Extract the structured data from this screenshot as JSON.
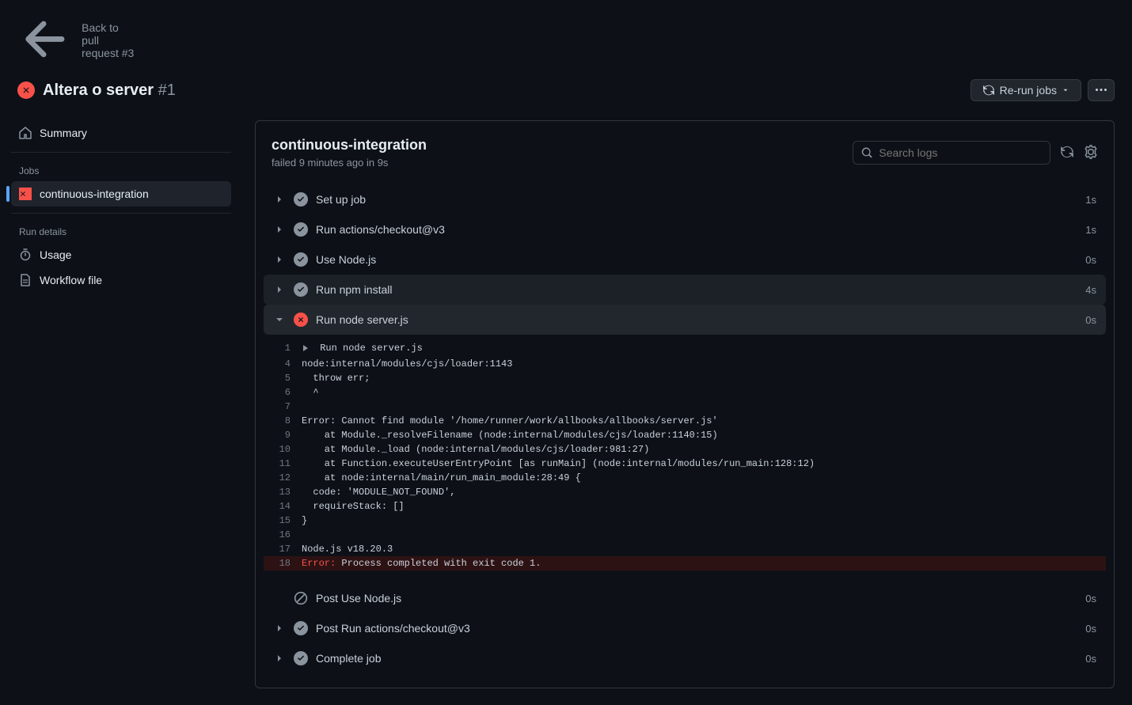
{
  "header": {
    "back_label": "Back to pull request #3",
    "title": "Altera o server",
    "title_number": "#1",
    "rerun_label": "Re-run jobs"
  },
  "sidebar": {
    "summary_label": "Summary",
    "jobs_heading": "Jobs",
    "jobs": [
      {
        "label": "continuous-integration",
        "status": "fail"
      }
    ],
    "details_heading": "Run details",
    "usage_label": "Usage",
    "workflow_label": "Workflow file"
  },
  "main": {
    "title": "continuous-integration",
    "subtitle": "failed 9 minutes ago in 9s",
    "search_placeholder": "Search logs"
  },
  "steps": [
    {
      "label": "Set up job",
      "status": "success",
      "time": "1s",
      "chev": true
    },
    {
      "label": "Run actions/checkout@v3",
      "status": "success",
      "time": "1s",
      "chev": true
    },
    {
      "label": "Use Node.js",
      "status": "success",
      "time": "0s",
      "chev": true
    },
    {
      "label": "Run npm install",
      "status": "success",
      "time": "4s",
      "chev": true,
      "hovered": true
    },
    {
      "label": "Run node server.js",
      "status": "fail",
      "time": "0s",
      "chev": true,
      "expanded": true
    },
    {
      "label": "Post Use Node.js",
      "status": "skip",
      "time": "0s",
      "chev": false
    },
    {
      "label": "Post Run actions/checkout@v3",
      "status": "success",
      "time": "0s",
      "chev": true
    },
    {
      "label": "Complete job",
      "status": "success",
      "time": "0s",
      "chev": true
    }
  ],
  "log": [
    {
      "n": "1",
      "fold": true,
      "text": "Run node server.js"
    },
    {
      "n": "4",
      "text": "node:internal/modules/cjs/loader:1143"
    },
    {
      "n": "5",
      "text": "  throw err;"
    },
    {
      "n": "6",
      "text": "  ^"
    },
    {
      "n": "7",
      "text": ""
    },
    {
      "n": "8",
      "text": "Error: Cannot find module '/home/runner/work/allbooks/allbooks/server.js'"
    },
    {
      "n": "9",
      "text": "    at Module._resolveFilename (node:internal/modules/cjs/loader:1140:15)"
    },
    {
      "n": "10",
      "text": "    at Module._load (node:internal/modules/cjs/loader:981:27)"
    },
    {
      "n": "11",
      "text": "    at Function.executeUserEntryPoint [as runMain] (node:internal/modules/run_main:128:12)"
    },
    {
      "n": "12",
      "text": "    at node:internal/main/run_main_module:28:49 {"
    },
    {
      "n": "13",
      "text": "  code: 'MODULE_NOT_FOUND',"
    },
    {
      "n": "14",
      "text": "  requireStack: []"
    },
    {
      "n": "15",
      "text": "}"
    },
    {
      "n": "16",
      "text": ""
    },
    {
      "n": "17",
      "text": "Node.js v18.20.3"
    },
    {
      "n": "18",
      "err": true,
      "errlabel": "Error:",
      "text": " Process completed with exit code 1."
    }
  ]
}
